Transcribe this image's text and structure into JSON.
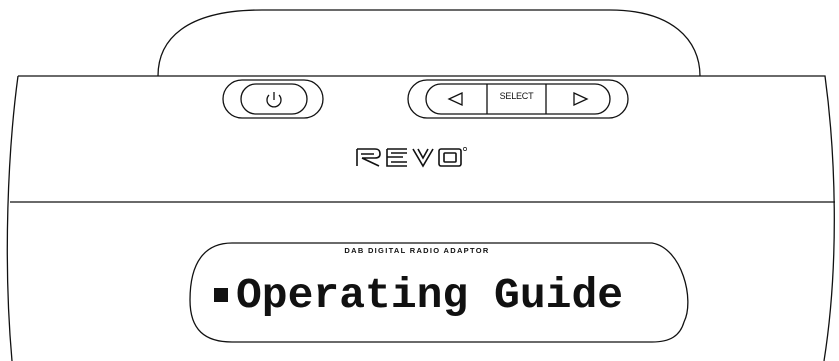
{
  "controls": {
    "power_icon": "power-icon",
    "left_icon": "left-arrow-icon",
    "select_label": "SELECT",
    "right_icon": "right-arrow-icon"
  },
  "brand": {
    "logo_text": "REVO",
    "logo_mark": "®"
  },
  "display": {
    "subtitle": "DAB DIGITAL RADIO ADAPTOR",
    "bullet_icon": "square-bullet-icon",
    "title": "Operating Guide"
  },
  "colors": {
    "line": "#111111",
    "background": "#ffffff"
  }
}
